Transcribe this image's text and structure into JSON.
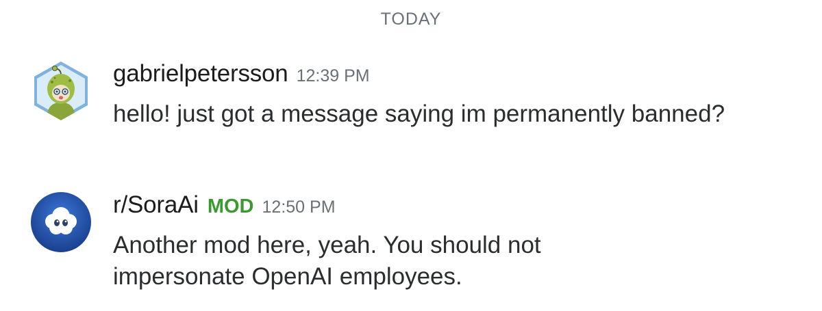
{
  "day_divider": "TODAY",
  "messages": [
    {
      "username": "gabrielpetersson",
      "badge": "",
      "time": "12:39 PM",
      "text": "hello! just got a message saying im permanently banned?",
      "avatar_icon": "snoo-avatar-icon"
    },
    {
      "username": "r/SoraAi",
      "badge": "MOD",
      "time": "12:50 PM",
      "text": "Another mod here, yeah. You should not impersonate OpenAI employees.",
      "avatar_icon": "cloud-face-icon"
    }
  ],
  "colors": {
    "mod_badge": "#3b9a2f",
    "timestamp": "#6a7078",
    "avatar_2_bg": "#1f4fa8"
  }
}
